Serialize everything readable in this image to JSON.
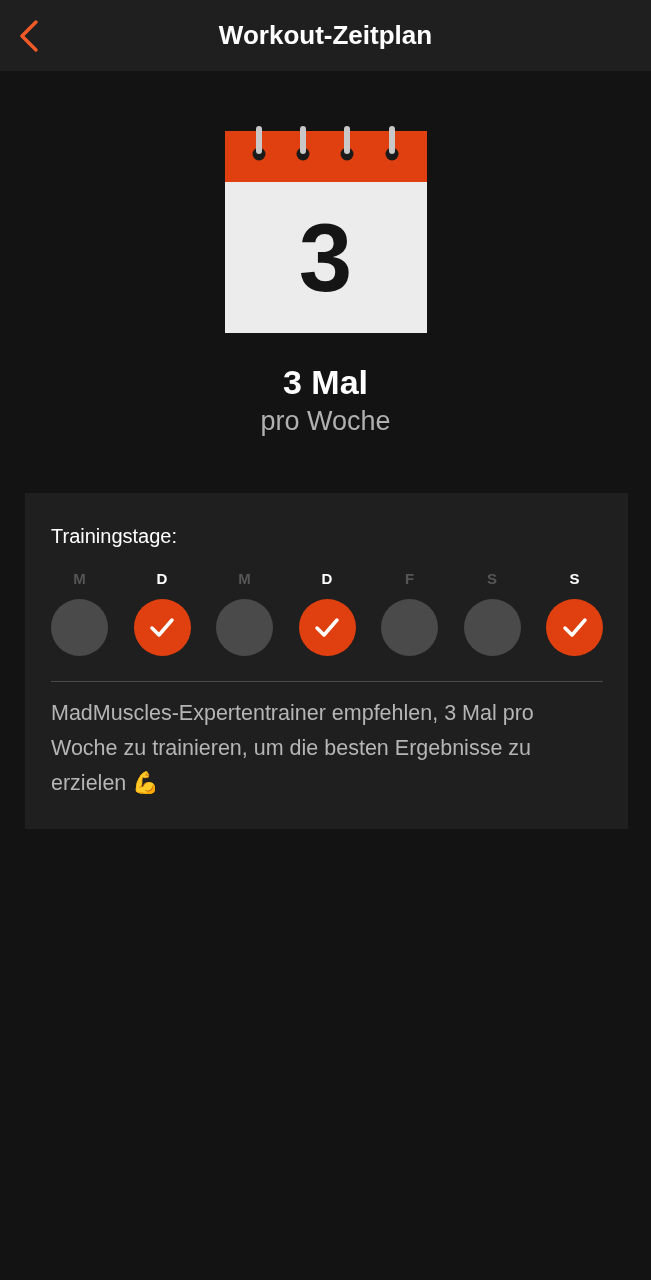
{
  "header": {
    "title": "Workout-Zeitplan"
  },
  "calendar": {
    "number": "3"
  },
  "summary": {
    "count": "3 Mal",
    "unit": "pro Woche"
  },
  "training_days": {
    "label": "Trainingstage:",
    "days": [
      {
        "label": "M",
        "checked": false
      },
      {
        "label": "D",
        "checked": true
      },
      {
        "label": "M",
        "checked": false
      },
      {
        "label": "D",
        "checked": true
      },
      {
        "label": "F",
        "checked": false
      },
      {
        "label": "S",
        "checked": false
      },
      {
        "label": "S",
        "checked": true
      }
    ],
    "note": "MadMuscles-Expertentrainer empfehlen, 3 Mal pro Woche zu trainieren, um die besten Ergebnisse zu erzielen 💪"
  }
}
